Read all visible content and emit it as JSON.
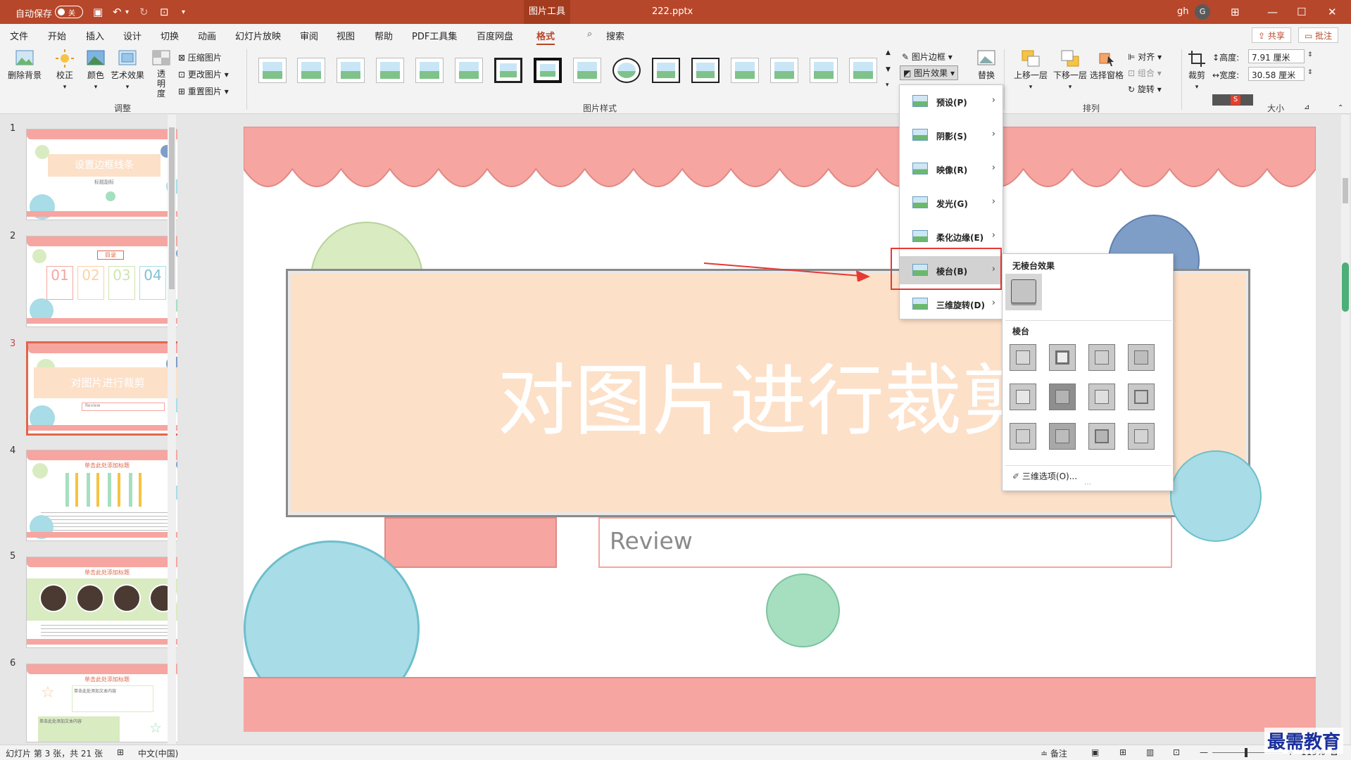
{
  "titlebar": {
    "autosave_label": "自动保存",
    "autosave_state": "关",
    "context_tab": "图片工具",
    "filename": "222.pptx",
    "user": "gh",
    "avatar_letter": "G"
  },
  "menu": {
    "tabs": [
      "文件",
      "开始",
      "插入",
      "设计",
      "切换",
      "动画",
      "幻灯片放映",
      "审阅",
      "视图",
      "帮助",
      "PDF工具集",
      "百度网盘",
      "格式"
    ],
    "search": "搜索",
    "share": "共享",
    "comment": "批注"
  },
  "ribbon": {
    "remove_bg": "删除背景",
    "correct": "校正",
    "color": "颜色",
    "artistic": "艺术效果",
    "transparency": "透明度",
    "compress": "压缩图片",
    "change": "更改图片",
    "reset": "重置图片",
    "group_adjust": "调整",
    "group_style": "图片样式",
    "border": "图片边框",
    "effects": "图片效果",
    "replace": "替换",
    "bring_forward": "上移一层",
    "send_backward": "下移一层",
    "selection_pane": "选择窗格",
    "align": "对齐",
    "group": "组合",
    "rotate": "旋转",
    "group_arrange": "排列",
    "crop": "裁剪",
    "height_label": "高度:",
    "height_value": "7.91 厘米",
    "width_label": "宽度:",
    "width_value": "30.58 厘米",
    "group_size": "大小"
  },
  "effects_menu": [
    "预设(P)",
    "阴影(S)",
    "映像(R)",
    "发光(G)",
    "柔化边缘(E)",
    "棱台(B)",
    "三维旋转(D)"
  ],
  "bevel_menu": {
    "no_bevel": "无棱台效果",
    "section": "棱台",
    "options": "三维选项(O)..."
  },
  "slides": {
    "s1_title": "设置边框线条",
    "s1_sub": "标题副标",
    "s2_title": "目录",
    "s2_nums": [
      "01",
      "02",
      "03",
      "04"
    ],
    "s3_title": "对图片进行裁剪",
    "s3_sub": "Review",
    "s4_title": "单击此处添加标题",
    "s5_title": "单击此处添加标题",
    "s6_title": "单击此处添加标题",
    "s6_text1": "单击此处添加文本内容",
    "s6_text2": "单击此处添加文本内容"
  },
  "slide_main": {
    "title": "对图片进行裁剪",
    "subtitle": "Review"
  },
  "status": {
    "slide_info": "幻灯片 第 3 张，共 21 张",
    "lang": "中文(中国)",
    "notes": "备注",
    "zoom": "119%"
  },
  "watermark": "最需教育",
  "colors": {
    "accent": "#b7472a",
    "scallop": "#f6a5a0",
    "peach": "#fde0c8",
    "teal": "#a8dce6",
    "green": "#d9ebc1",
    "blue": "#7f9ec7"
  }
}
